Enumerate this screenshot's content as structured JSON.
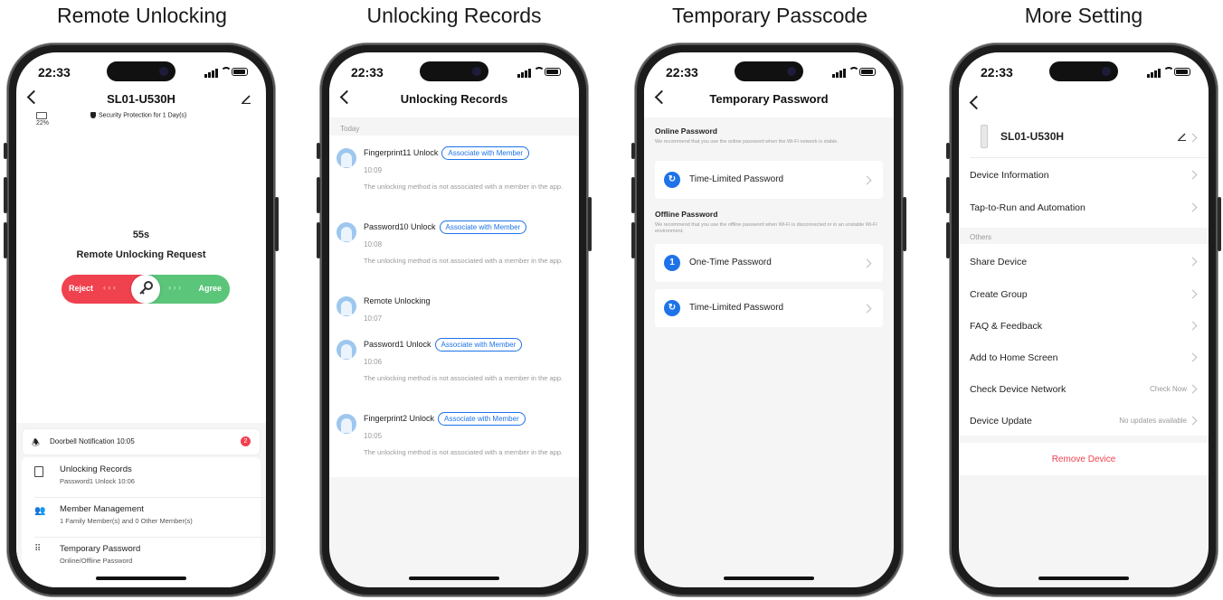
{
  "captions": [
    "Remote Unlocking",
    "Unlocking Records",
    "Temporary Passcode",
    "More Setting"
  ],
  "status": {
    "time": "22:33"
  },
  "screen1": {
    "title": "SL01-U530H",
    "battery": "22%",
    "security": "Security Protection for 1 Day(s)",
    "countdown": "55s",
    "request": "Remote Unlocking Request",
    "reject": "Reject",
    "agree": "Agree",
    "doorbell": "Doorbell Notification 10:05",
    "doorbell_badge": "2",
    "menu": [
      {
        "title": "Unlocking Records",
        "sub": "Password1 Unlock 10:06",
        "icon": "list-icon"
      },
      {
        "title": "Member Management",
        "sub": "1 Family Member(s) and 0 Other Member(s)",
        "icon": "members-icon"
      },
      {
        "title": "Temporary Password",
        "sub": "Online/Offline Password",
        "icon": "keypad-icon"
      }
    ]
  },
  "screen2": {
    "title": "Unlocking Records",
    "section": "Today",
    "associate": "Associate with Member",
    "note": "The unlocking method is not associated with a member in the app.",
    "records": [
      {
        "name": "Fingerprint11 Unlock",
        "time": "10:09",
        "tag": true
      },
      {
        "name": "Password10 Unlock",
        "time": "10:08",
        "tag": true
      },
      {
        "name": "Remote Unlocking",
        "time": "10:07",
        "tag": false
      },
      {
        "name": "Password1 Unlock",
        "time": "10:06",
        "tag": true
      },
      {
        "name": "Fingerprint2 Unlock",
        "time": "10:05",
        "tag": true
      }
    ]
  },
  "screen3": {
    "title": "Temporary Password",
    "online_header": "Online Password",
    "online_desc": "We recommend that you use the online password when the Wi-Fi network is stable.",
    "offline_header": "Offline Password",
    "offline_desc": "We recommend that you use the offline password when Wi-Fi is disconnected or in an unstable Wi-Fi environment.",
    "item_timed": "Time-Limited Password",
    "item_onetime": "One-Time Password",
    "item_timed2": "Time-Limited Password",
    "onetime_badge": "1"
  },
  "screen4": {
    "device": "SL01-U530H",
    "rows_top": [
      "Device Information",
      "Tap-to-Run and Automation"
    ],
    "others": "Others",
    "rows_others": [
      "Share Device",
      "Create Group",
      "FAQ & Feedback",
      "Add to Home Screen"
    ],
    "network": "Check Device Network",
    "network_value": "Check Now",
    "update": "Device Update",
    "update_value": "No updates available",
    "remove": "Remove Device"
  },
  "colors": {
    "accent": "#1e73e8",
    "reject": "#f0414f",
    "agree": "#5bc57a",
    "danger": "#f0414f"
  }
}
